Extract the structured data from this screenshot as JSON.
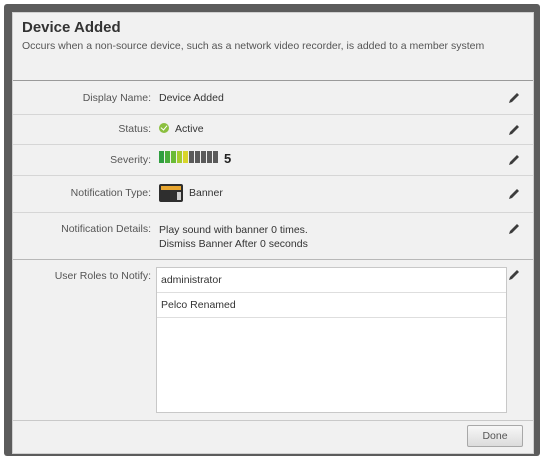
{
  "dialog": {
    "title": "Device Added",
    "description": "Occurs when a non-source device, such as a network video recorder, is added to a member system"
  },
  "fields": {
    "display_name": {
      "label": "Display Name:",
      "value": "Device Added"
    },
    "status": {
      "label": "Status:",
      "value": "Active",
      "color": "#8bbf3f"
    },
    "severity": {
      "label": "Severity:",
      "value": "5",
      "segment_colors": [
        "#2f9e3f",
        "#49ad3b",
        "#6bbb36",
        "#a6cc2f",
        "#d9d52b",
        "#5a5a5a",
        "#5a5a5a",
        "#5a5a5a",
        "#5a5a5a",
        "#5a5a5a"
      ]
    },
    "notification_type": {
      "label": "Notification Type:",
      "value": "Banner",
      "icon": "banner-icon"
    },
    "notification_details": {
      "label": "Notification Details:",
      "line1": "Play sound with banner 0 times.",
      "line2": "Dismiss Banner After 0 seconds"
    },
    "user_roles": {
      "label": "User Roles to Notify:",
      "items": [
        "administrator",
        "Pelco Renamed"
      ]
    }
  },
  "edit_icon": "pencil-icon",
  "footer": {
    "done_label": "Done"
  }
}
